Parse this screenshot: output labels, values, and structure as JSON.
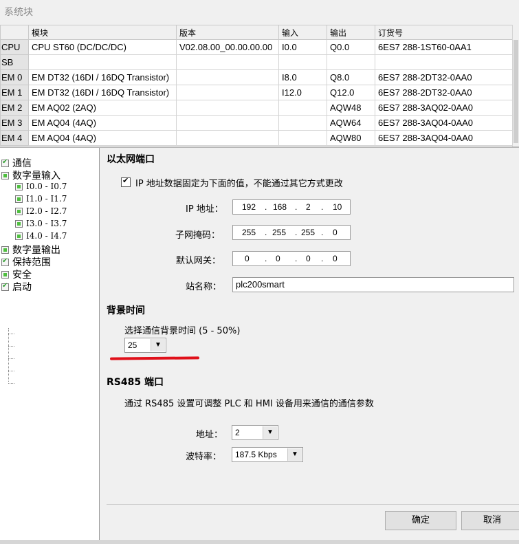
{
  "window": {
    "title": "系统块"
  },
  "modules": {
    "headers": [
      "",
      "模块",
      "版本",
      "输入",
      "输出",
      "订货号"
    ],
    "rows": [
      {
        "slot": "CPU",
        "module": "CPU ST60 (DC/DC/DC)",
        "version": "V02.08.00_00.00.00.00",
        "input": "I0.0",
        "output": "Q0.0",
        "order": "6ES7 288-1ST60-0AA1"
      },
      {
        "slot": "SB",
        "module": "",
        "version": "",
        "input": "",
        "output": "",
        "order": ""
      },
      {
        "slot": "EM 0",
        "module": "EM DT32 (16DI / 16DQ Transistor)",
        "version": "",
        "input": "I8.0",
        "output": "Q8.0",
        "order": "6ES7 288-2DT32-0AA0"
      },
      {
        "slot": "EM 1",
        "module": "EM DT32 (16DI / 16DQ Transistor)",
        "version": "",
        "input": "I12.0",
        "output": "Q12.0",
        "order": "6ES7 288-2DT32-0AA0"
      },
      {
        "slot": "EM 2",
        "module": "EM AQ02 (2AQ)",
        "version": "",
        "input": "",
        "output": "AQW48",
        "order": "6ES7 288-3AQ02-0AA0"
      },
      {
        "slot": "EM 3",
        "module": "EM AQ04 (4AQ)",
        "version": "",
        "input": "",
        "output": "AQW64",
        "order": "6ES7 288-3AQ04-0AA0"
      },
      {
        "slot": "EM 4",
        "module": "EM AQ04 (4AQ)",
        "version": "",
        "input": "",
        "output": "AQW80",
        "order": "6ES7 288-3AQ04-0AA0"
      }
    ]
  },
  "tree": {
    "comm": "通信",
    "di": "数字量输入",
    "di_items": [
      "I0.0 - I0.7",
      "I1.0 - I1.7",
      "I2.0 - I2.7",
      "I3.0 - I3.7",
      "I4.0 - I4.7"
    ],
    "dq": "数字量输出",
    "retain": "保持范围",
    "security": "安全",
    "startup": "启动"
  },
  "ethernet": {
    "heading": "以太网端口",
    "fixed_ip_label": "IP 地址数据固定为下面的值，不能通过其它方式更改",
    "ip_label": "IP 地址：",
    "ip": [
      "192",
      "168",
      "2",
      "10"
    ],
    "mask_label": "子网掩码：",
    "mask": [
      "255",
      "255",
      "255",
      "0"
    ],
    "gateway_label": "默认网关：",
    "gateway": [
      "0",
      "0",
      "0",
      "0"
    ],
    "station_label": "站名称：",
    "station": "plc200smart"
  },
  "background": {
    "heading": "背景时间",
    "label": "选择通信背景时间 (5 - 50%)",
    "value": "25"
  },
  "rs485": {
    "heading": "RS485 端口",
    "desc": "通过 RS485 设置可调整 PLC 和 HMI 设备用来通信的通信参数",
    "address_label": "地址：",
    "address": "2",
    "baud_label": "波特率：",
    "baud": "187.5 Kbps"
  },
  "buttons": {
    "ok": "确定",
    "cancel": "取消"
  },
  "colors": {
    "underline": "#e0101a",
    "check_green": "#4fbf3f"
  }
}
